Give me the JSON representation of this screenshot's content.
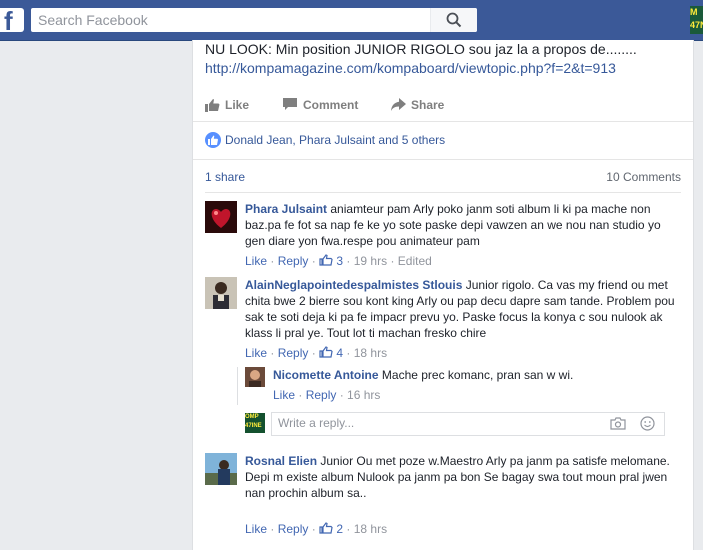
{
  "header": {
    "logo": "f",
    "search": {
      "placeholder": "Search Facebook",
      "value": ""
    },
    "corner_avatar_text": "M\n47N"
  },
  "post": {
    "text": "NU LOOK: Min position JUNIOR RIGOLO sou jaz la a propos de........",
    "link": "http://kompamagazine.com/kompaboard/viewtopic.php?f=2&t=913",
    "actions": {
      "like": "Like",
      "comment": "Comment",
      "share": "Share"
    },
    "likes_text": "Donald Jean, Phara Julsaint and 5 others",
    "shares_text": "1 share",
    "comments_count": "10 Comments"
  },
  "comments": [
    {
      "name": "Phara Julsaint",
      "text": "aniamteur pam Arly poko janm soti album li ki pa mache non baz.pa fe fot sa nap fe ke yo sote paske depi vawzen an we nou nan studio yo gen diare yon fwa.respe pou animateur pam",
      "like": "Like",
      "reply": "Reply",
      "likes": "3",
      "time": "19 hrs",
      "edited": "Edited"
    },
    {
      "name": "AlainNeglapointedespalmistes Stlouis",
      "text": "Junior rigolo. Ca vas my friend ou met chita bwe 2 bierre sou kont king Arly ou pap decu dapre sam tande. Problem pou sak te soti deja ki pa fe impacr prevu yo. Paske focus la konya c sou nulook ak klass li pral ye. Tout lot ti machan fresko chire",
      "like": "Like",
      "reply": "Reply",
      "likes": "4",
      "time": "18 hrs"
    },
    {
      "name": "Nicomette Antoine",
      "text": "Mache prec komanc, pran san w wi.",
      "like": "Like",
      "reply": "Reply",
      "time": "16 hrs"
    },
    {
      "name": "Rosnal Elien",
      "text": "Junior Ou met poze w.Maestro Arly pa janm pa satisfe melomane.",
      "text2": "Depi m existe album Nulook pa janm pa bon Se bagay swa tout moun pral jwen nan prochin album sa..",
      "like": "Like",
      "reply": "Reply",
      "likes": "2",
      "time": "18 hrs"
    }
  ],
  "reply_box": {
    "placeholder": "Write a reply...",
    "avatar_text": "OMP\n47INE"
  },
  "colors": {
    "brand": "#3b5998",
    "link": "#365899",
    "meta": "#90949c",
    "like_blue": "#5890ff"
  }
}
